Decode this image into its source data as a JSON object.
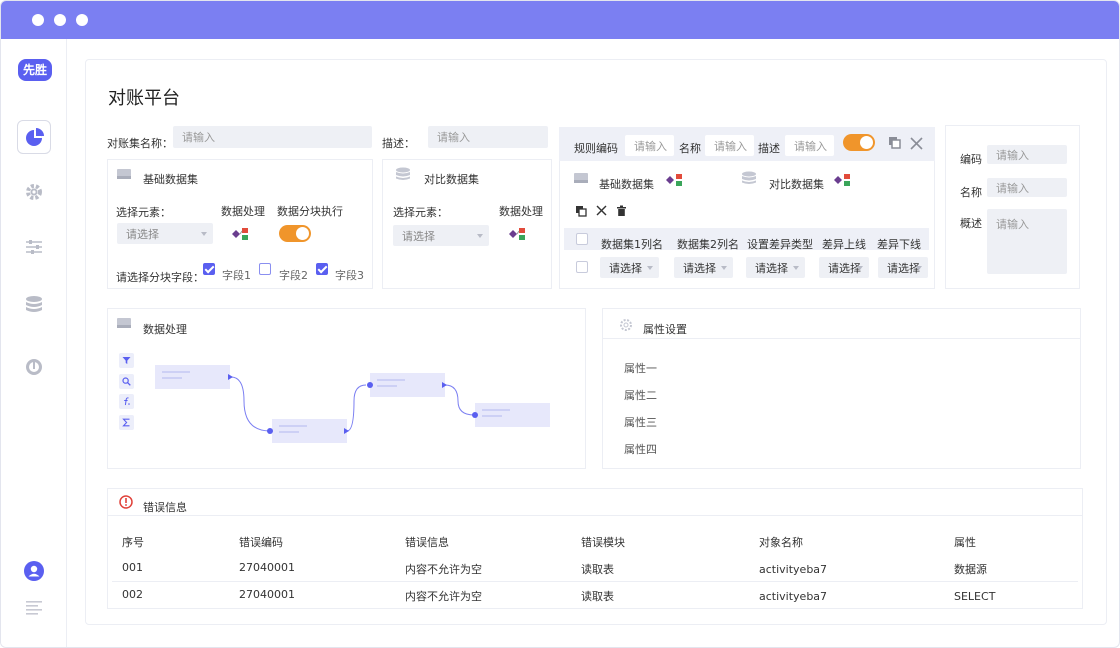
{
  "app": {
    "logo_text": "先胜",
    "page_title": "对账平台"
  },
  "form": {
    "dataset_name_label": "对账集名称：",
    "dataset_name_placeholder": "请输入",
    "desc_label": "描述：",
    "desc_placeholder": "请输入"
  },
  "base_panel": {
    "title": "基础数据集",
    "select_elem_label": "选择元素：",
    "select_placeholder": "请选择",
    "data_process_label": "数据处理",
    "block_exec_label": "数据分块执行",
    "block_field_label": "请选择分块字段：",
    "fields": [
      {
        "label": "字段1",
        "checked": true
      },
      {
        "label": "字段2",
        "checked": false
      },
      {
        "label": "字段3",
        "checked": true
      }
    ]
  },
  "compare_panel": {
    "title": "对比数据集",
    "select_elem_label": "选择元素：",
    "select_placeholder": "请选择",
    "data_process_label": "数据处理"
  },
  "rule_panel": {
    "rule_code_label": "规则编码",
    "rule_code_placeholder": "请输入",
    "name_label": "名称",
    "name_placeholder": "请输入",
    "desc_label": "描述",
    "desc_placeholder": "请输入",
    "base_dataset": "基础数据集",
    "compare_dataset": "对比数据集",
    "columns": [
      "数据集1列名",
      "数据集2列名",
      "设置差异类型",
      "差异上线",
      "差异下线"
    ],
    "row_selects": [
      "请选择",
      "请选择",
      "请选择",
      "请选择",
      "请选择"
    ]
  },
  "right_panel": {
    "code_label": "编码",
    "code_placeholder": "请输入",
    "name_label": "名称",
    "name_placeholder": "请输入",
    "summary_label": "概述",
    "summary_placeholder": "请输入"
  },
  "process_panel": {
    "title": "数据处理"
  },
  "attr_panel": {
    "title": "属性设置",
    "items": [
      "属性一",
      "属性二",
      "属性三",
      "属性四"
    ]
  },
  "error_panel": {
    "title": "错误信息",
    "columns": [
      "序号",
      "错误编码",
      "错误信息",
      "错误模块",
      "对象名称",
      "属性"
    ],
    "rows": [
      [
        "001",
        "27040001",
        "内容不允许为空",
        "读取表",
        "activityeba7",
        "数据源"
      ],
      [
        "002",
        "27040001",
        "内容不允许为空",
        "读取表",
        "activityeba7",
        "SELECT"
      ]
    ]
  },
  "colors": {
    "titlebar": "#7b7ff2",
    "accent": "#5a5ff0",
    "toggle": "#f0952b",
    "error": "#e0423a"
  },
  "icons": [
    "pie-chart-icon",
    "gear-icon",
    "sliders-icon",
    "database-icon",
    "gauge-icon",
    "user-icon",
    "menu-lines-icon",
    "copy-icon",
    "close-icon",
    "delete-icon",
    "flow-icon",
    "filter-icon",
    "search-icon",
    "function-icon",
    "sigma-icon",
    "error-icon"
  ]
}
